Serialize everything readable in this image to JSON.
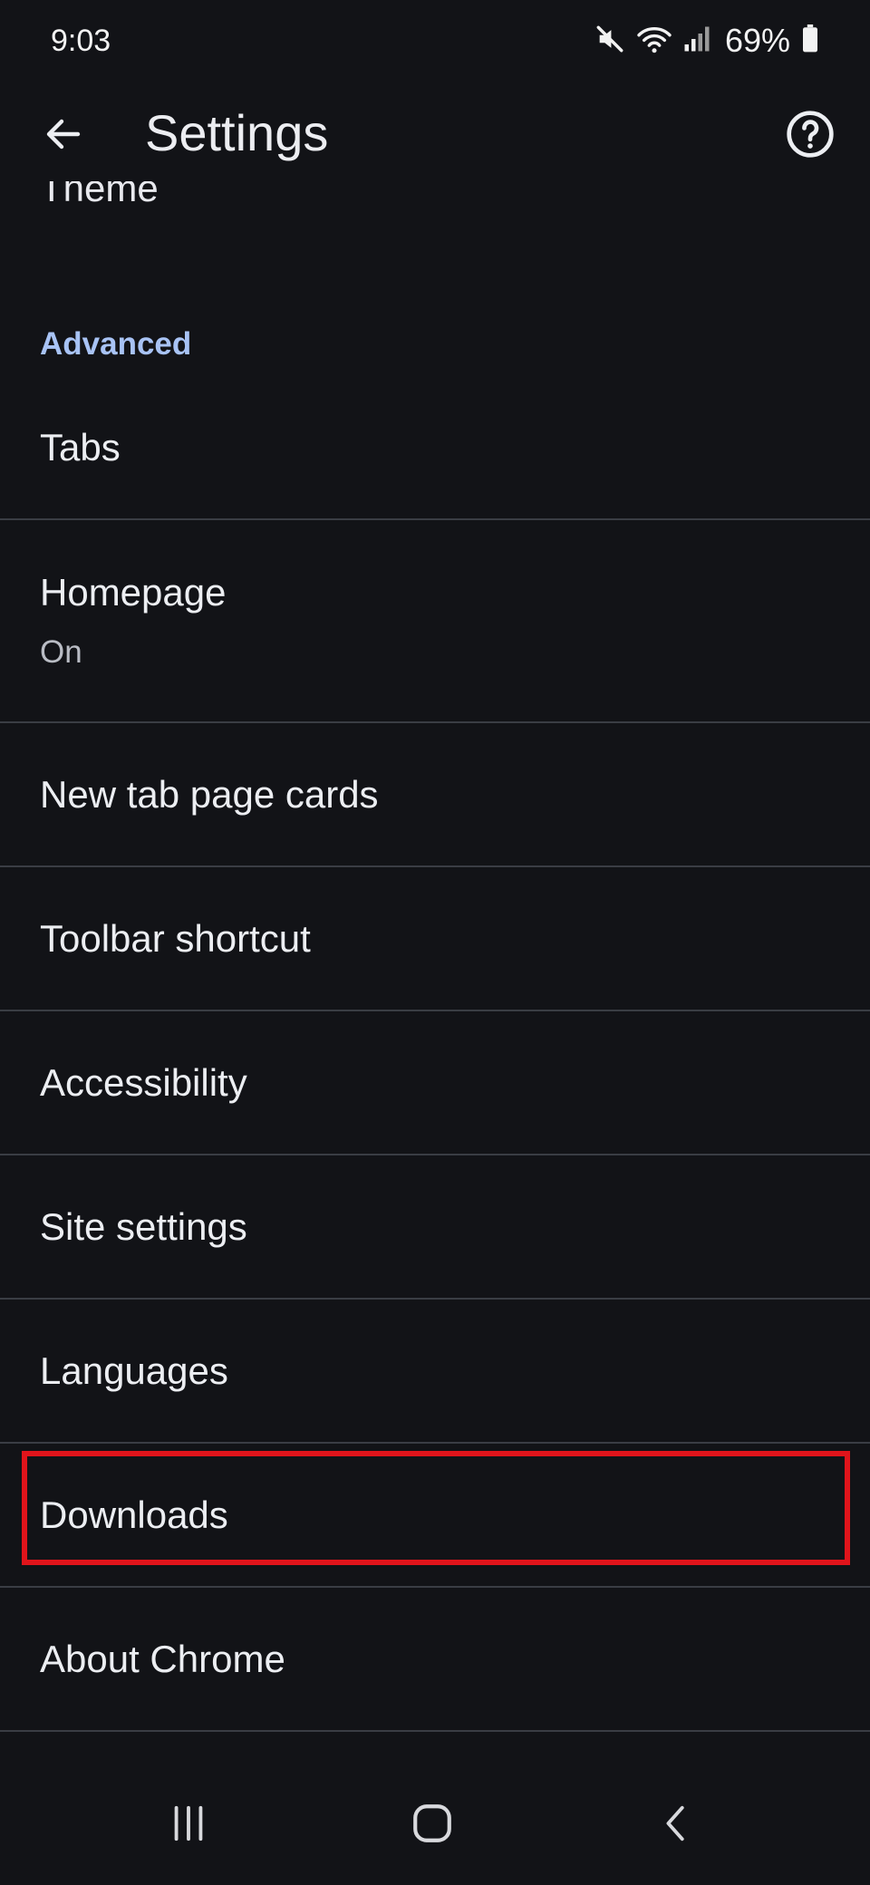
{
  "status_bar": {
    "time": "9:03",
    "battery_percent": "69%",
    "icons": [
      "mute-icon",
      "wifi-icon",
      "signal-icon",
      "battery-icon"
    ]
  },
  "app_bar": {
    "title": "Settings",
    "back_icon": "arrow-left-icon",
    "help_icon": "help-circle-icon"
  },
  "partial_item": {
    "label": "Theme"
  },
  "section": {
    "title": "Advanced"
  },
  "items": [
    {
      "label": "Tabs"
    },
    {
      "label": "Homepage",
      "sub": "On"
    },
    {
      "label": "New tab page cards"
    },
    {
      "label": "Toolbar shortcut"
    },
    {
      "label": "Accessibility"
    },
    {
      "label": "Site settings"
    },
    {
      "label": "Languages"
    },
    {
      "label": "Downloads",
      "highlighted": true
    },
    {
      "label": "About Chrome"
    }
  ],
  "colors": {
    "background": "#121317",
    "accent": "#a8c3f5",
    "divider": "#3a3d44",
    "highlight": "#e0141b"
  },
  "nav_bar": {
    "icons": [
      "recents-icon",
      "home-icon",
      "back-chevron-icon"
    ]
  }
}
